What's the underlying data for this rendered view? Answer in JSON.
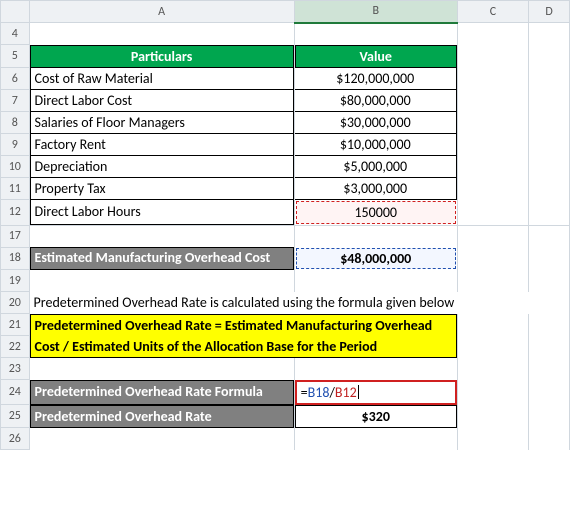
{
  "columns": {
    "A": "A",
    "B": "B",
    "C": "C",
    "D": "D"
  },
  "rows": [
    "4",
    "5",
    "6",
    "7",
    "8",
    "9",
    "10",
    "11",
    "12",
    "17",
    "18",
    "19",
    "20",
    "21",
    "22",
    "23",
    "24",
    "25",
    "26"
  ],
  "table": {
    "header_particulars": "Particulars",
    "header_value": "Value",
    "rows": [
      {
        "label": "Cost of Raw Material",
        "value": "$120,000,000"
      },
      {
        "label": "Direct Labor Cost",
        "value": "$80,000,000"
      },
      {
        "label": "Salaries of Floor Managers",
        "value": "$30,000,000"
      },
      {
        "label": "Factory Rent",
        "value": "$10,000,000"
      },
      {
        "label": "Depreciation",
        "value": "$5,000,000"
      },
      {
        "label": "Property Tax",
        "value": "$3,000,000"
      },
      {
        "label": "Direct Labor Hours",
        "value": "150000"
      }
    ]
  },
  "estimated_overhead": {
    "label": "Estimated Manufacturing Overhead Cost",
    "value": "$48,000,000"
  },
  "explain": "Predetermined Overhead Rate is calculated using the formula given below",
  "formula_text_line1": "Predetermined Overhead Rate = Estimated Manufacturing Overhead",
  "formula_text_line2": "Cost / Estimated Units of the Allocation Base for the Period",
  "rate": {
    "formula_label": "Predetermined Overhead Rate Formula",
    "formula_eq_prefix": "=",
    "formula_ref1": "B18",
    "formula_slash": "/",
    "formula_ref2": "B12",
    "result_label": "Predetermined Overhead Rate",
    "result_value": "$320"
  },
  "chart_data": {
    "type": "table",
    "title": "Predetermined Overhead Rate Calculation",
    "rows": [
      {
        "Particulars": "Cost of Raw Material",
        "Value": 120000000
      },
      {
        "Particulars": "Direct Labor Cost",
        "Value": 80000000
      },
      {
        "Particulars": "Salaries of Floor Managers",
        "Value": 30000000
      },
      {
        "Particulars": "Factory Rent",
        "Value": 10000000
      },
      {
        "Particulars": "Depreciation",
        "Value": 5000000
      },
      {
        "Particulars": "Property Tax",
        "Value": 3000000
      },
      {
        "Particulars": "Direct Labor Hours",
        "Value": 150000
      },
      {
        "Particulars": "Estimated Manufacturing Overhead Cost",
        "Value": 48000000
      },
      {
        "Particulars": "Predetermined Overhead Rate",
        "Value": 320
      }
    ],
    "formula": "Predetermined Overhead Rate = Estimated Manufacturing Overhead Cost / Estimated Units of the Allocation Base for the Period"
  }
}
